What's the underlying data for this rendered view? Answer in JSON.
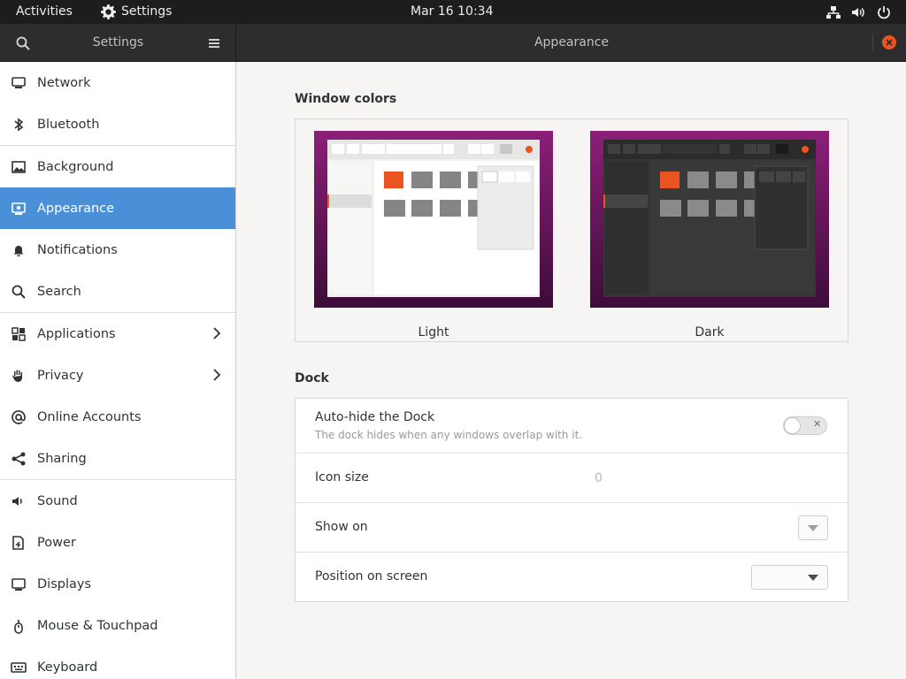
{
  "topbar": {
    "activities": "Activities",
    "app_name": "Settings",
    "clock": "Mar 16  10:34"
  },
  "header": {
    "left_title": "Settings",
    "title": "Appearance"
  },
  "sidebar": {
    "items": [
      {
        "label": "Network",
        "icon": "network-icon"
      },
      {
        "label": "Bluetooth",
        "icon": "bluetooth-icon"
      },
      {
        "label": "Background",
        "icon": "background-icon"
      },
      {
        "label": "Appearance",
        "icon": "appearance-icon",
        "active": true
      },
      {
        "label": "Notifications",
        "icon": "bell-icon"
      },
      {
        "label": "Search",
        "icon": "search-icon"
      },
      {
        "label": "Applications",
        "icon": "grid-icon",
        "has_submenu": true
      },
      {
        "label": "Privacy",
        "icon": "hand-icon",
        "has_submenu": true
      },
      {
        "label": "Online Accounts",
        "icon": "at-icon"
      },
      {
        "label": "Sharing",
        "icon": "share-icon"
      },
      {
        "label": "Sound",
        "icon": "speaker-icon"
      },
      {
        "label": "Power",
        "icon": "power-plug-icon"
      },
      {
        "label": "Displays",
        "icon": "display-icon"
      },
      {
        "label": "Mouse & Touchpad",
        "icon": "mouse-icon"
      },
      {
        "label": "Keyboard",
        "icon": "keyboard-icon"
      }
    ]
  },
  "main": {
    "window_colors": {
      "title": "Window colors",
      "options": [
        {
          "label": "Light"
        },
        {
          "label": "Dark"
        }
      ]
    },
    "dock": {
      "title": "Dock",
      "auto_hide": {
        "label": "Auto-hide the Dock",
        "description": "The dock hides when any windows overlap with it.",
        "enabled": false
      },
      "icon_size": {
        "label": "Icon size",
        "value": "0"
      },
      "show_on": {
        "label": "Show on",
        "value": ""
      },
      "position": {
        "label": "Position on screen",
        "value": ""
      }
    }
  },
  "colors": {
    "accent": "#4a90d9",
    "ubuntu_orange": "#e95420",
    "wallpaper_purple": "#77216f"
  }
}
